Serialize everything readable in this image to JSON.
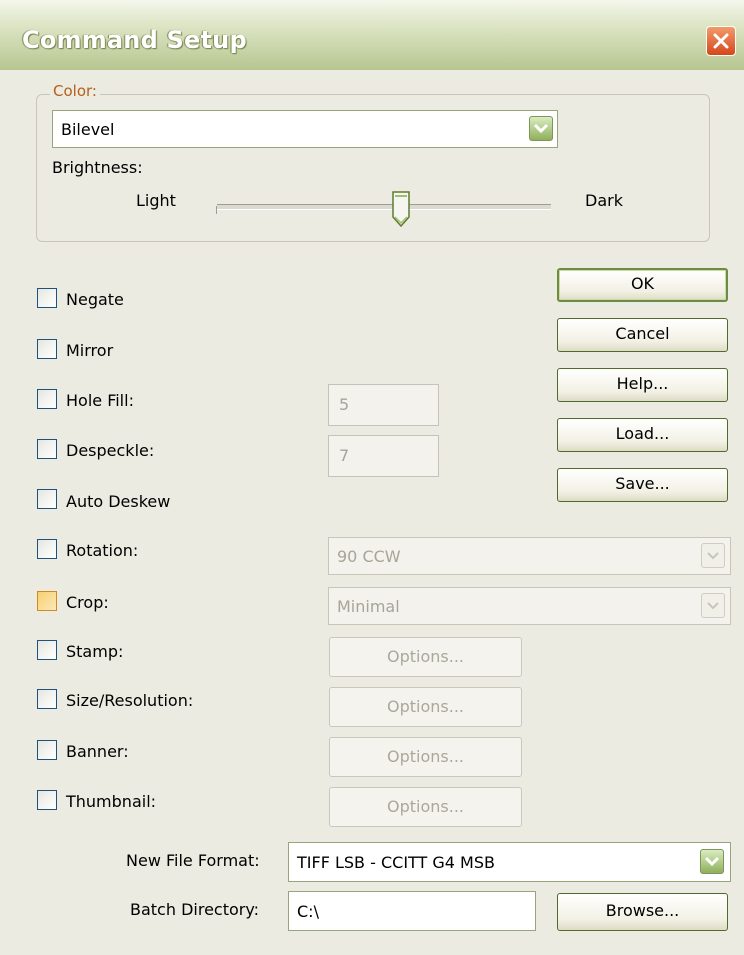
{
  "window": {
    "title": "Command Setup",
    "close_icon": "close-x-icon"
  },
  "color_group": {
    "label": "Color:",
    "color_select": {
      "value": "Bilevel"
    },
    "brightness_label": "Brightness:",
    "light_label": "Light",
    "dark_label": "Dark",
    "brightness_level_fraction": 0.55
  },
  "options": {
    "negate": "Negate",
    "mirror": "Mirror",
    "hole_fill": "Hole Fill:",
    "despeckle": "Despeckle:",
    "auto_deskew": "Auto Deskew",
    "rotation": "Rotation:",
    "crop": "Crop:",
    "stamp": "Stamp:",
    "size_resolution": "Size/Resolution:",
    "banner": "Banner:",
    "thumbnail": "Thumbnail:"
  },
  "values": {
    "hole_fill": "5",
    "despeckle": "7",
    "rotation": "90 CCW",
    "crop": "Minimal"
  },
  "option_button_label": "Options...",
  "buttons": {
    "ok": "OK",
    "cancel": "Cancel",
    "help": "Help...",
    "load": "Load...",
    "save": "Save...",
    "browse": "Browse..."
  },
  "file_format": {
    "label": "New File Format:",
    "value": "TIFF LSB - CCITT G4 MSB"
  },
  "batch_directory": {
    "label": "Batch Directory:",
    "value": "C:\\"
  },
  "colors": {
    "title_bar": "#b6c690",
    "group_label": "#b45f1c",
    "close_button": "#d5461c"
  }
}
